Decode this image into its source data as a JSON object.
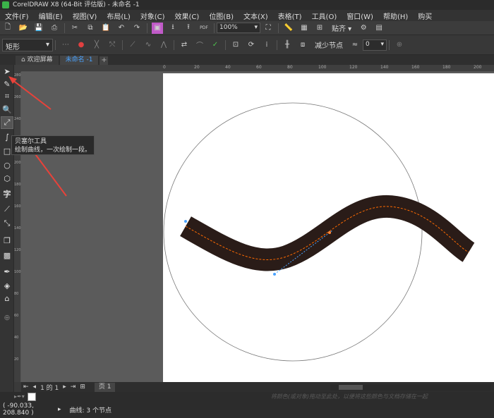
{
  "window": {
    "title": "CorelDRAW X8 (64-Bit 评估版) - 未命名 -1"
  },
  "menu": [
    "文件(F)",
    "编辑(E)",
    "视图(V)",
    "布局(L)",
    "对象(C)",
    "效果(C)",
    "位图(B)",
    "文本(X)",
    "表格(T)",
    "工具(O)",
    "窗口(W)",
    "帮助(H)",
    "购买"
  ],
  "toolbar": {
    "zoom_value": "100%",
    "snap_label": "贴齐",
    "pdf_label": "PDF"
  },
  "property_bar": {
    "shape_value": "矩形",
    "reduce_nodes_label": "减少节点",
    "smooth_value": "0"
  },
  "tabs": {
    "welcome": "欢迎屏幕",
    "document": "未命名 -1",
    "add": "+"
  },
  "ruler": {
    "h_labels": [
      "0",
      "20",
      "40",
      "60",
      "80",
      "100",
      "120",
      "140",
      "160",
      "180",
      "200"
    ],
    "v_labels": [
      "280",
      "260",
      "240",
      "220",
      "200",
      "180",
      "160",
      "140",
      "120",
      "100",
      "80",
      "60",
      "40",
      "20"
    ]
  },
  "tooltip": {
    "title": "贝塞尔工具",
    "description": "绘制曲线，一次绘制一段。"
  },
  "pagebar": {
    "page_of": "1 的 1",
    "page_tab": "页 1"
  },
  "palette": {
    "hint": "将颜色(或对象)拖动至此处，以便将这些颜色与文档存储在一起"
  },
  "status": {
    "coords": "( -90.033, 208.840 )",
    "object_info": "曲线: 3 个节点"
  },
  "colors": {
    "curve": "#2a1c18",
    "accent": "#ff6a00",
    "arrow": "#e8423a",
    "active_tab": "#4aa3ff"
  },
  "icons": [
    "pick-icon",
    "freehand-icon",
    "crop-icon",
    "zoom-icon",
    "bezier-icon",
    "artistic-media-icon",
    "rectangle-icon",
    "ellipse-icon",
    "polygon-icon",
    "text-icon",
    "connector-icon",
    "blend-icon",
    "drop-shadow-icon",
    "transparency-icon",
    "eyedropper-icon",
    "fill-icon",
    "smart-fill-icon",
    "add-tool-icon"
  ]
}
